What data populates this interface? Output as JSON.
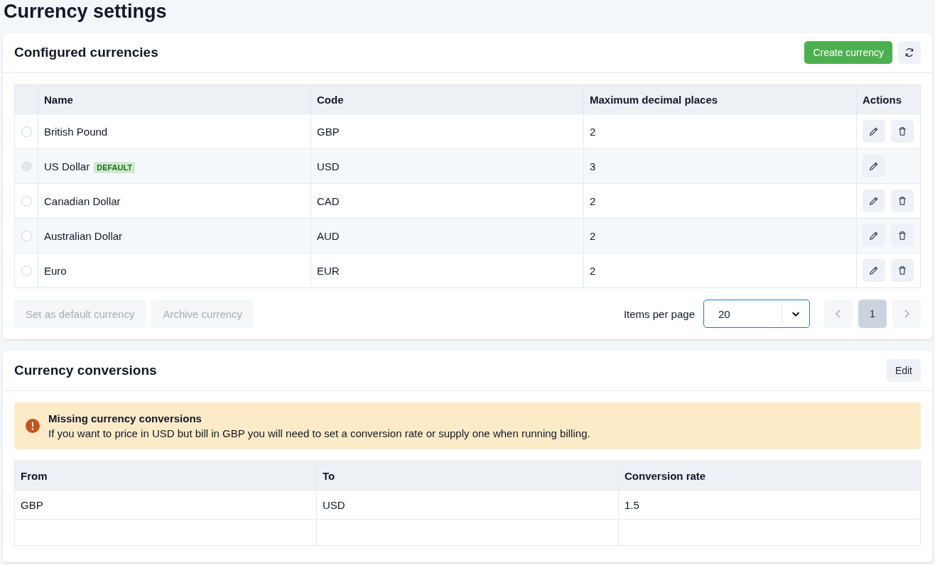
{
  "page_title": "Currency settings",
  "currencies_card": {
    "title": "Configured currencies",
    "create_button": "Create currency",
    "columns": [
      "Name",
      "Code",
      "Maximum decimal places",
      "Actions"
    ],
    "rows": [
      {
        "name": "British Pound",
        "code": "GBP",
        "decimals": "2",
        "selected": false,
        "disabled": false,
        "can_delete": true
      },
      {
        "name": "US Dollar",
        "badge": "DEFAULT",
        "code": "USD",
        "decimals": "3",
        "selected": false,
        "disabled": true,
        "can_delete": false
      },
      {
        "name": "Canadian Dollar",
        "code": "CAD",
        "decimals": "2",
        "selected": false,
        "disabled": false,
        "can_delete": true
      },
      {
        "name": "Australian Dollar",
        "code": "AUD",
        "decimals": "2",
        "selected": false,
        "disabled": false,
        "can_delete": true
      },
      {
        "name": "Euro",
        "code": "EUR",
        "decimals": "2",
        "selected": false,
        "disabled": false,
        "can_delete": true
      }
    ],
    "bulk_actions": [
      {
        "label": "Set as default currency",
        "disabled": true
      },
      {
        "label": "Archive currency",
        "disabled": true
      }
    ],
    "items_per_page": {
      "label": "Items per page",
      "value": "20"
    },
    "pagination": {
      "prev_disabled": true,
      "next_disabled": true,
      "pages": [
        {
          "label": "1",
          "selected": true
        }
      ]
    }
  },
  "conversions_card": {
    "title": "Currency conversions",
    "edit_button": "Edit",
    "alert": {
      "title": "Missing currency conversions",
      "message": "If you want to price in USD but bill in GBP you will need to set a conversion rate or supply one when running billing."
    },
    "columns": [
      "From",
      "To",
      "Conversion rate"
    ],
    "rows": [
      {
        "from": "GBP",
        "to": "USD",
        "rate": "1.5"
      }
    ]
  }
}
